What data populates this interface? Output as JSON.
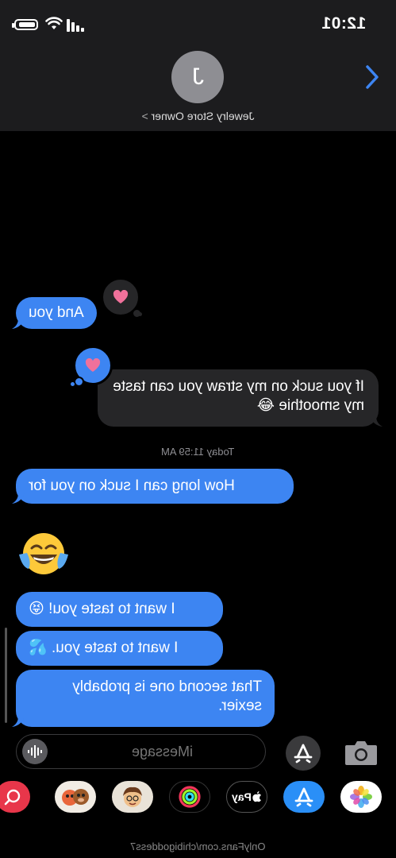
{
  "status_bar": {
    "time": "12:01"
  },
  "header": {
    "avatar_letter": "J",
    "contact_name": "Jewelry Store Owner",
    "contact_chevron": ">"
  },
  "messages": [
    {
      "side": "sent",
      "text": "And you",
      "tapback": "heart"
    },
    {
      "side": "received",
      "text": "If you suck on my straw you can taste my smoothie 😂",
      "tapback": "heart"
    },
    {
      "timestamp": "Today 11:59 AM"
    },
    {
      "side": "sent",
      "text": "How long can I suck on you for"
    },
    {
      "side": "sent",
      "emoji": "😂"
    },
    {
      "side": "sent",
      "text": "I want to taste you! 😝"
    },
    {
      "side": "sent",
      "text": "I want to taste you. 💦"
    },
    {
      "side": "sent",
      "text": "That second one is probably sexier."
    }
  ],
  "input": {
    "placeholder": "iMessage"
  },
  "app_drawer": {
    "apps": [
      "photos-app",
      "app-store-app",
      "apple-pay-app",
      "activity-app",
      "memoji-app",
      "animoji-app",
      "search-app"
    ],
    "apple_pay_label": "Pay"
  },
  "watermark": "OnlyFans.com/chibigoddess7",
  "colors": {
    "sent_bubble": "#3d85f2",
    "received_bubble": "#262628",
    "heart": "#f0719b",
    "background": "#000000",
    "header": "#1c1c1e"
  }
}
